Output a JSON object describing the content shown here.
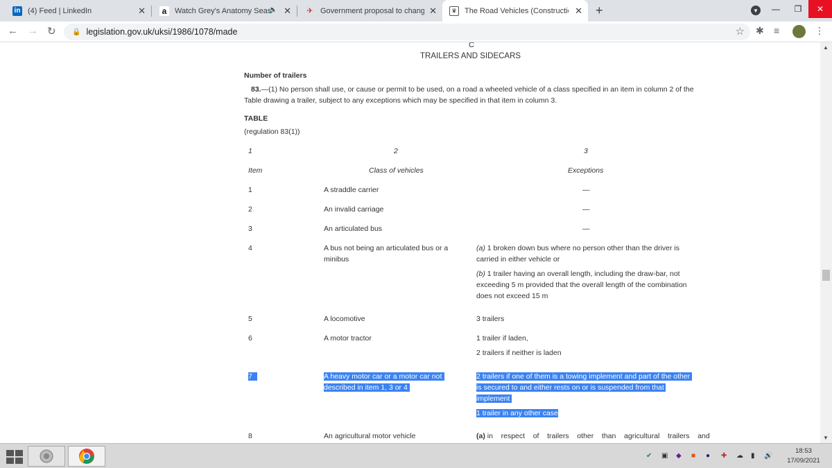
{
  "browser": {
    "tabs": [
      {
        "favicon": "in",
        "title": "(4) Feed | LinkedIn"
      },
      {
        "favicon": "a",
        "title": "Watch Grey's Anatomy Seaso"
      },
      {
        "favicon": "gov",
        "title": "Government proposal to change"
      },
      {
        "favicon": "crest",
        "title": "The Road Vehicles (Construction"
      }
    ],
    "new_tab": "+",
    "url": "legislation.gov.uk/uksi/1986/1078/made"
  },
  "doc": {
    "part_letter": "C",
    "part_title": "TRAILERS AND SIDECARS",
    "section_heading": "Number of trailers",
    "para_number": "83.",
    "para_line1": "—(1) No person shall use, or cause or permit to be used, on a road a wheeled vehicle of a class specified in an item in column 2 of the",
    "para_line2": "Table drawing a trailer, subject to any exceptions which may be specified in that item in column 3.",
    "table_title": "TABLE",
    "table_ref": "(regulation 83(1))",
    "col_numbers": [
      "1",
      "2",
      "3"
    ],
    "col_headers": [
      "Item",
      "Class of vehicles",
      "Exceptions"
    ],
    "rows": [
      {
        "item": "1",
        "cls": [
          "A straddle carrier"
        ],
        "exc": [
          "—"
        ]
      },
      {
        "item": "2",
        "cls": [
          "An invalid carriage"
        ],
        "exc": [
          "—"
        ]
      },
      {
        "item": "3",
        "cls": [
          "An articulated bus"
        ],
        "exc": [
          "—"
        ]
      },
      {
        "item": "4",
        "cls": [
          "A bus not being an articulated bus or a",
          "minibus"
        ],
        "exc_a_label": "(a)",
        "exc_a": [
          "1 broken down bus where no person other than the driver is",
          "carried in either vehicle or"
        ],
        "exc_b_label": "(b)",
        "exc_b": [
          "1 trailer having an overall length, including the draw-bar, not",
          "exceeding 5 m provided that the overall length of the combination",
          "does not exceed 15 m"
        ]
      },
      {
        "item": "5",
        "cls": [
          "A locomotive"
        ],
        "exc": [
          "3 trailers"
        ]
      },
      {
        "item": "6",
        "cls": [
          "A motor tractor"
        ],
        "exc": [
          "1 trailer if laden,",
          "2 trailers if neither is laden"
        ]
      },
      {
        "item": "7",
        "cls": [
          "A heavy motor car or a motor car not",
          "described in item 1, 3 or 4"
        ],
        "exc": [
          "2 trailers if one of them is a towing implement and part of the other",
          "is secured to and either rests on or is suspended from that",
          "implement",
          "1 trailer in any other case"
        ]
      },
      {
        "item": "8",
        "cls": [
          "An agricultural motor vehicle"
        ],
        "exc_label": "(a)",
        "exc": [
          "in    respect    of    trailers    other    than    agricultural    trailers    and"
        ]
      }
    ]
  },
  "taskbar": {
    "time": "18:53",
    "date": "17/09/2021"
  },
  "colors": {
    "selection": "#3a82f2",
    "tabbar": "#dee1e6",
    "close_button": "#e81123"
  }
}
